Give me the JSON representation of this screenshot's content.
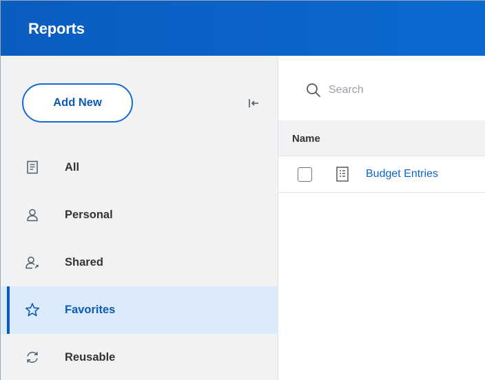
{
  "header": {
    "title": "Reports"
  },
  "sidebar": {
    "add_new_label": "Add New",
    "collapse_icon": "collapse-left-icon",
    "items": [
      {
        "label": "All",
        "icon": "document-list-icon",
        "active": false
      },
      {
        "label": "Personal",
        "icon": "person-icon",
        "active": false
      },
      {
        "label": "Shared",
        "icon": "shared-person-icon",
        "active": false
      },
      {
        "label": "Favorites",
        "icon": "star-icon",
        "active": true
      },
      {
        "label": "Reusable",
        "icon": "refresh-icon",
        "active": false
      }
    ]
  },
  "main": {
    "search": {
      "placeholder": "Search"
    },
    "table": {
      "columns": [
        "Name"
      ],
      "rows": [
        {
          "name": "Budget Entries",
          "icon": "report-grid-icon",
          "checked": false
        }
      ]
    }
  },
  "colors": {
    "header_bg": "#0b5cbf",
    "accent": "#0b59b8",
    "link": "#0b64c9",
    "active_bg": "#dcebfa",
    "sidebar_bg": "#f1f2f4"
  }
}
